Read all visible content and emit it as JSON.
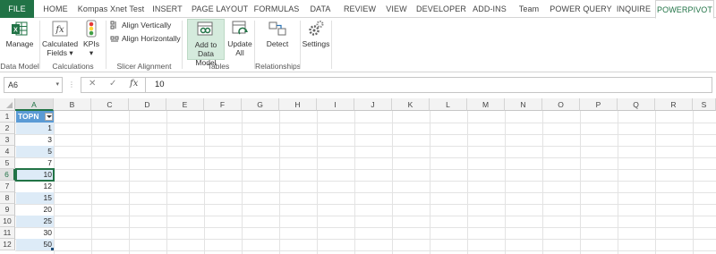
{
  "tabs": [
    {
      "label": "FILE"
    },
    {
      "label": "HOME"
    },
    {
      "label": "Kompas Xnet Test"
    },
    {
      "label": "INSERT"
    },
    {
      "label": "PAGE LAYOUT"
    },
    {
      "label": "FORMULAS"
    },
    {
      "label": "DATA"
    },
    {
      "label": "REVIEW"
    },
    {
      "label": "VIEW"
    },
    {
      "label": "DEVELOPER"
    },
    {
      "label": "ADD-INS"
    },
    {
      "label": "Team"
    },
    {
      "label": "POWER QUERY"
    },
    {
      "label": "INQUIRE"
    },
    {
      "label": "POWERPIVOT"
    }
  ],
  "active_tab": "POWERPIVOT",
  "ribbon": {
    "data_model": {
      "label": "Data Model",
      "manage": "Manage"
    },
    "calculations": {
      "label": "Calculations",
      "calculated_fields_1": "Calculated",
      "calculated_fields_2": "Fields ▾",
      "kpis_1": "KPIs",
      "kpis_2": "▾"
    },
    "slicer_alignment": {
      "label": "Slicer Alignment",
      "align_vertically": "Align Vertically",
      "align_horizontally": "Align Horizontally"
    },
    "tables": {
      "label": "Tables",
      "add_to_data_model_1": "Add to",
      "add_to_data_model_2": "Data Model",
      "update_all_1": "Update",
      "update_all_2": "All"
    },
    "relationships": {
      "label": "Relationships",
      "detect": "Detect"
    },
    "settings": {
      "label": "Settings"
    }
  },
  "formula_bar": {
    "name_box": "A6",
    "dropdown": "▾",
    "cancel": "✕",
    "enter": "✓",
    "fx": "fx",
    "value": "10"
  },
  "grid": {
    "columns": [
      "A",
      "B",
      "C",
      "D",
      "E",
      "F",
      "G",
      "H",
      "I",
      "J",
      "K",
      "L",
      "M",
      "N",
      "O",
      "P",
      "Q",
      "R",
      "S"
    ],
    "rows": [
      "1",
      "2",
      "3",
      "4",
      "5",
      "6",
      "7",
      "8",
      "9",
      "10",
      "11",
      "12"
    ],
    "selected_column": "A",
    "selected_row": "6",
    "table_header": "TOPN",
    "column_a_values": [
      "1",
      "3",
      "5",
      "7",
      "10",
      "12",
      "15",
      "20",
      "25",
      "30",
      "50"
    ]
  },
  "colors": {
    "excel_green": "#217346",
    "table_header": "#5b9bd5",
    "table_band": "#ddebf7"
  }
}
